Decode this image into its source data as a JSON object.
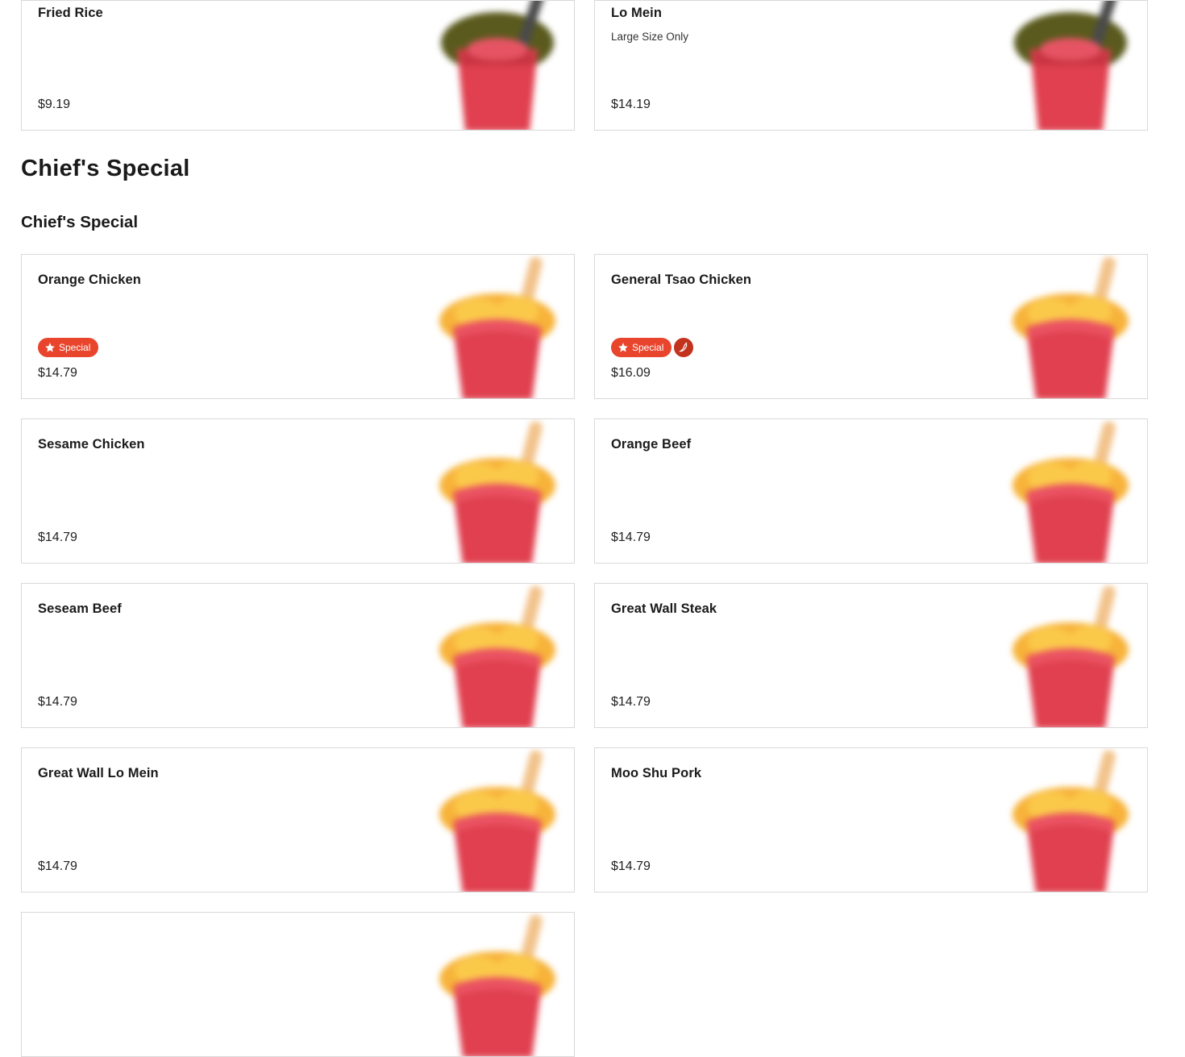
{
  "top_items": [
    {
      "name": "Fried Rice",
      "desc": "",
      "price": "$9.19"
    },
    {
      "name": "Lo Mein",
      "desc": "Large Size Only",
      "price": "$14.19"
    }
  ],
  "section": {
    "title": "Chief's Special",
    "subtitle": "Chief's Special"
  },
  "special_badge_label": "Special",
  "items": [
    {
      "name": "Orange Chicken",
      "price": "$14.79",
      "special": true,
      "spicy": false
    },
    {
      "name": "General Tsao Chicken",
      "price": "$16.09",
      "special": true,
      "spicy": true
    },
    {
      "name": "Sesame Chicken",
      "price": "$14.79"
    },
    {
      "name": "Orange Beef",
      "price": "$14.79"
    },
    {
      "name": "Seseam Beef",
      "price": "$14.79"
    },
    {
      "name": "Great Wall Steak",
      "price": "$14.79"
    },
    {
      "name": "Great Wall Lo Mein",
      "price": "$14.79"
    },
    {
      "name": "Moo Shu Pork",
      "price": "$14.79"
    }
  ],
  "colors": {
    "badge_special": "#e8452c",
    "badge_spicy": "#c2321c",
    "box_red": "#e0404f",
    "card_border": "#d9d9d9"
  },
  "icons": {
    "noodle_box": "noodle-box-icon",
    "food_box": "food-box-icon",
    "star": "star-icon",
    "pepper": "chili-pepper-icon"
  }
}
